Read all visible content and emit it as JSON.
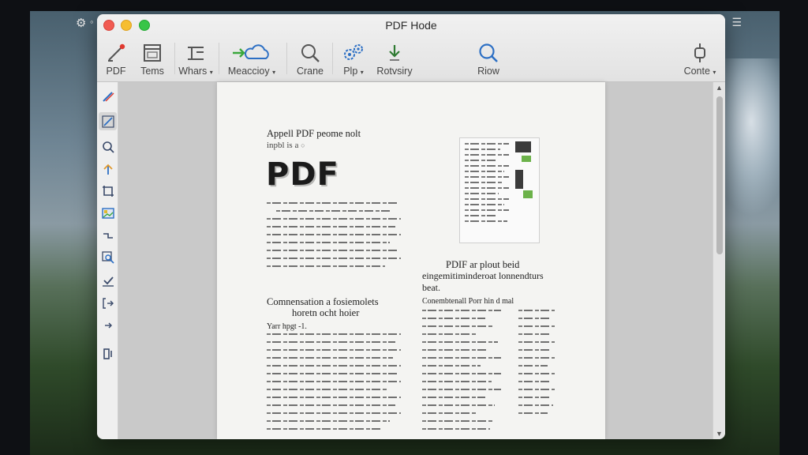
{
  "window": {
    "title": "PDF Hode",
    "controls": [
      "close",
      "minimize",
      "maximize"
    ]
  },
  "toolbar": {
    "items": [
      {
        "label": "PDF",
        "icon": "pen-line-icon"
      },
      {
        "label": "Tems",
        "icon": "window-icon"
      },
      {
        "label": "Whars",
        "icon": "text-format-icon",
        "dropdown": true
      },
      {
        "label": "Meaccioy",
        "icon": "cloud-arrow-icon",
        "dropdown": true
      },
      {
        "label": "Crane",
        "icon": "search-icon"
      },
      {
        "label": "Plp",
        "icon": "gears-icon",
        "dropdown": true
      },
      {
        "label": "Rotvsiry",
        "icon": "download-arrow-icon"
      },
      {
        "label": "Riow",
        "icon": "search-icon"
      },
      {
        "label": "Conte",
        "icon": "plug-icon",
        "dropdown": true
      }
    ]
  },
  "sidebar": {
    "tools": [
      {
        "icon": "pencil-highlight-icon",
        "active": false
      },
      {
        "icon": "line-draw-icon",
        "active": true
      },
      {
        "icon": "zoom-icon",
        "active": false
      },
      {
        "icon": "arrow-up-icon",
        "active": false
      },
      {
        "icon": "crop-icon",
        "active": false
      },
      {
        "icon": "image-icon",
        "active": false
      },
      {
        "icon": "curve-icon",
        "active": false
      },
      {
        "icon": "zoom-select-icon",
        "active": false
      },
      {
        "icon": "checkbox-icon",
        "active": false
      },
      {
        "icon": "bracket-arrow-icon",
        "active": false
      },
      {
        "icon": "arrow-right-icon",
        "active": false
      },
      {
        "icon": "panel-icon",
        "active": false
      }
    ]
  },
  "document": {
    "heading_line1": "Appell PDF peome nolt",
    "heading_line2": "inpbl is a",
    "big_title": "PDF",
    "section1_title_line1": "Comnensation a fosiemolets",
    "section1_title_line2": "horetn ocht hoier",
    "section1_subhead": "Yarr hpgt -1.",
    "right_title_line1": "PDIF ar plout beid",
    "right_title_line2": "eingemitiminderoat lonnendturs",
    "right_title_line3": "beat.",
    "right_subhead": "Conembtenall Porr hin d mal"
  },
  "colors": {
    "accent_green": "#3aa83c",
    "accent_blue": "#2c6fc4",
    "record_red": "#e0392f"
  }
}
